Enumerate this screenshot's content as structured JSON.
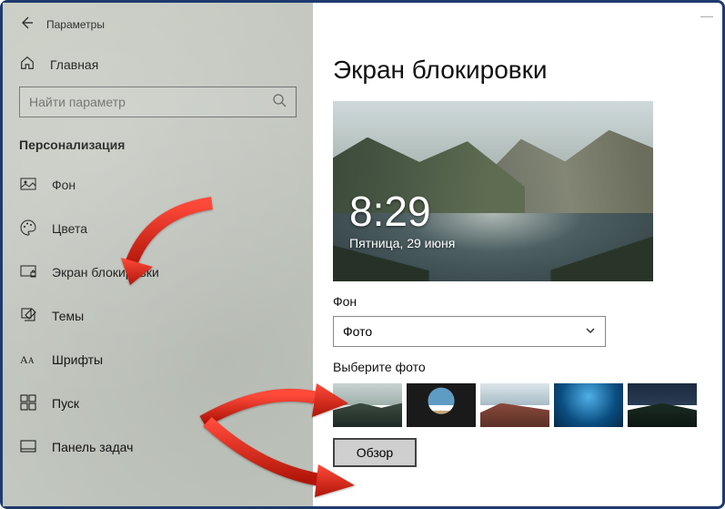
{
  "window": {
    "title": "Параметры",
    "home_label": "Главная",
    "search_placeholder": "Найти параметр"
  },
  "section_title": "Персонализация",
  "nav": [
    {
      "id": "bg",
      "label": "Фон"
    },
    {
      "id": "colors",
      "label": "Цвета"
    },
    {
      "id": "lock",
      "label": "Экран блокировки"
    },
    {
      "id": "themes",
      "label": "Темы"
    },
    {
      "id": "fonts",
      "label": "Шрифты"
    },
    {
      "id": "start",
      "label": "Пуск"
    },
    {
      "id": "taskbar",
      "label": "Панель задач"
    }
  ],
  "page": {
    "title": "Экран блокировки",
    "clock_time": "8:29",
    "clock_date": "Пятница, 29 июня",
    "bg_label": "Фон",
    "bg_value": "Фото",
    "pick_label": "Выберите фото",
    "browse_label": "Обзор"
  }
}
